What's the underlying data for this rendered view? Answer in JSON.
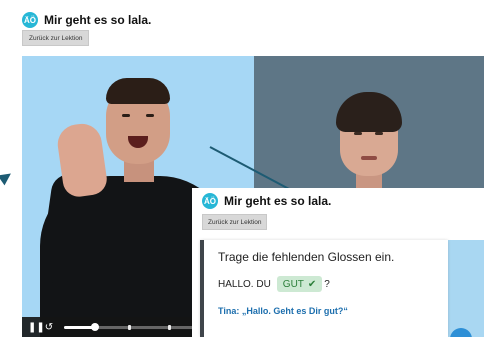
{
  "app": {
    "title": "Mir geht es so lala.",
    "logo_text": "ÄÖ",
    "back_label": "Zurück zur Lektion"
  },
  "video": {
    "controls": {
      "pause_icon": "pause-icon",
      "replay_icon": "replay-icon",
      "progress_percent": 22
    }
  },
  "popup": {
    "title": "Mir geht es so lala.",
    "logo_text": "ÄÖ",
    "back_label": "Zurück zur Lektion",
    "prompt": "Trage die fehlenden Glossen ein.",
    "prefix": "HALLO. DU",
    "answer": "GUT",
    "suffix": "?",
    "dialog": "Tina: „Hallo. Geht es Dir gut?“"
  },
  "colors": {
    "accent": "#27b7d6",
    "video_bg": "#a6d7f5",
    "arrow": "#1d5b73",
    "answer_bg": "#cde9d3",
    "dialog_blue": "#1d6fae"
  }
}
